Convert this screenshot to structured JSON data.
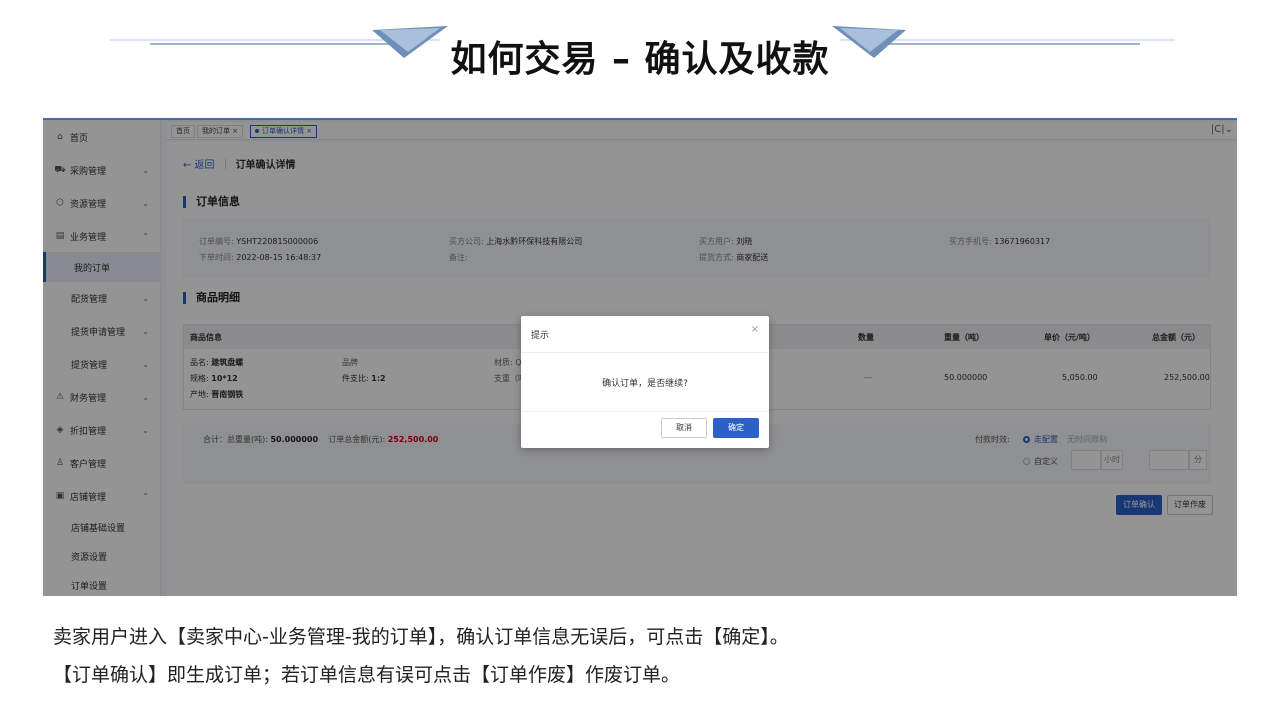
{
  "slide": {
    "title": "如何交易 – 确认及收款",
    "caption_line1": "卖家用户进入【卖家中心-业务管理-我的订单】，确认订单信息无误后，可点击【确定】。",
    "caption_line2": "【订单确认】即生成订单；若订单信息有误可点击【订单作废】作废订单。"
  },
  "sidebar": {
    "items": [
      {
        "label": "首页",
        "icon": "home-icon"
      },
      {
        "label": "采购管理",
        "icon": "truck-icon"
      },
      {
        "label": "资源管理",
        "icon": "cube-icon"
      },
      {
        "label": "业务管理",
        "icon": "calendar-icon"
      },
      {
        "label": "我的订单"
      },
      {
        "label": "配货管理"
      },
      {
        "label": "提货申请管理"
      },
      {
        "label": "提货管理"
      },
      {
        "label": "财务管理",
        "icon": "warning-icon"
      },
      {
        "label": "折扣管理",
        "icon": "tag-icon"
      },
      {
        "label": "客户管理",
        "icon": "users-icon"
      },
      {
        "label": "店铺管理",
        "icon": "store-icon"
      },
      {
        "label": "店铺基础设置"
      },
      {
        "label": "资源设置"
      },
      {
        "label": "订单设置"
      }
    ]
  },
  "tabs": {
    "home": "首页",
    "orders": "我的订单",
    "detail": "订单确认详情",
    "close": "×"
  },
  "page": {
    "back": "← 返回",
    "title": "订单确认详情",
    "section_order": "订单信息",
    "section_goods": "商品明细"
  },
  "order_info": {
    "no_label": "订单编号:",
    "no_value": "YSHT220815000006",
    "time_label": "下单时间:",
    "time_value": "2022-08-15 16:48:37",
    "company_label": "买方公司:",
    "company_value": "上海水黔环保科技有限公司",
    "remark_label": "备注:",
    "buyer_label": "买方用户:",
    "buyer_value": "刘晓",
    "delivery_label": "提货方式:",
    "delivery_value": "商家配送",
    "phone_label": "买方手机号:",
    "phone_value": "13671960317"
  },
  "goods_table": {
    "headers": {
      "info": "商品信息",
      "qty": "数量",
      "weight": "重量（吨）",
      "price": "单价（元/吨）",
      "total": "总金额（元）"
    },
    "row": {
      "name_label": "品名:",
      "name_value": "建筑盘螺",
      "spec_label": "规格:",
      "spec_value": "10*12",
      "origin_label": "产地:",
      "origin_value": "晋南钢铁",
      "brand_label": "品牌",
      "pieces_label": "件支比:",
      "pieces_value": "1:2",
      "material_label": "材质: Q",
      "support_label": "支重（吨",
      "qty": "---",
      "weight": "50.000000",
      "price": "5,050.00",
      "total": "252,500.00"
    }
  },
  "summary": {
    "total_label": "合计：总重量(吨):",
    "total_weight": "50.000000",
    "amount_label": "订单总金额(元):",
    "amount_value": "252,500.00",
    "pay_label": "付款时效:",
    "opt_default": "走配置",
    "opt_nolimit": "无时间限制",
    "opt_custom": "自定义",
    "unit_hour": "小时",
    "unit_min": "分"
  },
  "actions": {
    "confirm": "订单确认",
    "void": "订单作废"
  },
  "dialog": {
    "title": "提示",
    "close": "×",
    "message": "确认订单，是否继续?",
    "cancel": "取消",
    "ok": "确定"
  },
  "colors": {
    "accent": "#2b61c6",
    "amount_red": "#d0021b",
    "overlay": "rgba(0,0,0,0.42)"
  }
}
